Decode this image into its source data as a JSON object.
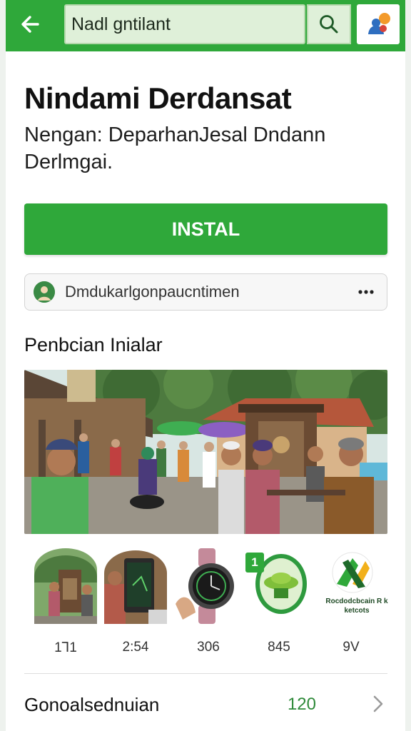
{
  "colors": {
    "accent": "#2fa83a",
    "search_bg": "#dff0d9",
    "value_green": "#2f8a3a"
  },
  "topbar": {
    "back_icon": "arrow-left-icon",
    "search": {
      "value": "Nadl gntilant"
    },
    "search_icon": "search-icon",
    "account_icon": "avatar-icon"
  },
  "app": {
    "title": "Nindami Derdansat",
    "subtitle": "Nengan: DeparhanJesal Dndann Derlmgai."
  },
  "install": {
    "label": "INSTAL"
  },
  "developer": {
    "name": "Dmdukarlgonpaucntimen",
    "more_icon": "more-horizontal-icon"
  },
  "section": {
    "title": "Penbcian Inialar"
  },
  "thumbnails": [
    {
      "value": "1Ꞁ1"
    },
    {
      "value": "2:54"
    },
    {
      "value": "306"
    },
    {
      "value": "845"
    },
    {
      "value": "9V"
    }
  ],
  "badge_number": "1",
  "logo_caption": "Rocdodcbcain R k ketcots",
  "footer_row": {
    "label": "Gonoalsednuian",
    "value": "120",
    "chevron_icon": "chevron-right-icon"
  }
}
